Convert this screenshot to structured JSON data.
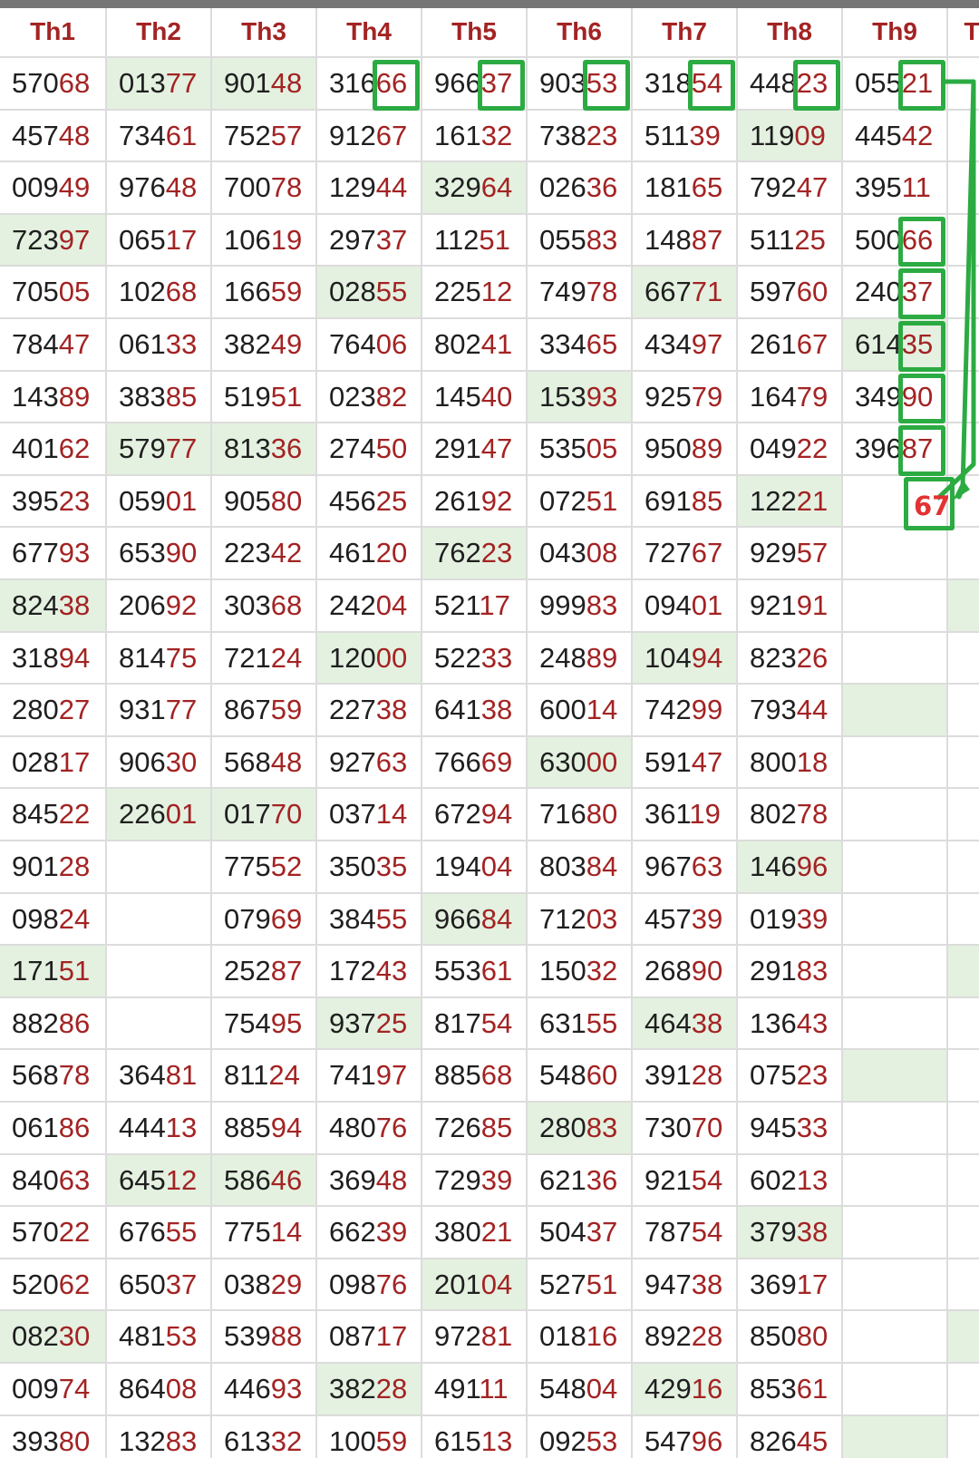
{
  "headers": [
    "Th1",
    "Th2",
    "Th3",
    "Th4",
    "Th5",
    "Th6",
    "Th7",
    "Th8",
    "Th9",
    "T"
  ],
  "rows": [
    [
      "57068",
      "01377",
      "90148",
      "31666",
      "96637",
      "90353",
      "31854",
      "44823",
      "05521",
      ""
    ],
    [
      "45748",
      "73461",
      "75257",
      "91267",
      "16132",
      "73823",
      "51139",
      "11909",
      "44542",
      ""
    ],
    [
      "00949",
      "97648",
      "70078",
      "12944",
      "32964",
      "02636",
      "18165",
      "79247",
      "39511",
      ""
    ],
    [
      "72397",
      "06517",
      "10619",
      "29737",
      "11251",
      "05583",
      "14887",
      "51125",
      "50066",
      ""
    ],
    [
      "70505",
      "10268",
      "16659",
      "02855",
      "22512",
      "74978",
      "66771",
      "59760",
      "24037",
      ""
    ],
    [
      "78447",
      "06133",
      "38249",
      "76406",
      "80241",
      "33465",
      "43497",
      "26167",
      "61435",
      ""
    ],
    [
      "14389",
      "38385",
      "51951",
      "02382",
      "14540",
      "15393",
      "92579",
      "16479",
      "34990",
      ""
    ],
    [
      "40162",
      "57977",
      "81336",
      "27450",
      "29147",
      "53505",
      "95089",
      "04922",
      "39687",
      ""
    ],
    [
      "39523",
      "05901",
      "90580",
      "45625",
      "26192",
      "07251",
      "69185",
      "12221",
      "",
      ""
    ],
    [
      "67793",
      "65390",
      "22342",
      "46120",
      "76223",
      "04308",
      "72767",
      "92957",
      "",
      ""
    ],
    [
      "82438",
      "20692",
      "30368",
      "24204",
      "52117",
      "99983",
      "09401",
      "92191",
      "",
      ""
    ],
    [
      "31894",
      "81475",
      "72124",
      "12000",
      "52233",
      "24889",
      "10494",
      "82326",
      "",
      ""
    ],
    [
      "28027",
      "93177",
      "86759",
      "22738",
      "64138",
      "60014",
      "74299",
      "79344",
      "",
      ""
    ],
    [
      "02817",
      "90630",
      "56848",
      "92763",
      "76669",
      "63000",
      "59147",
      "80018",
      "",
      ""
    ],
    [
      "84522",
      "22601",
      "01770",
      "03714",
      "67294",
      "71680",
      "36119",
      "80278",
      "",
      ""
    ],
    [
      "90128",
      "",
      "77552",
      "35035",
      "19404",
      "80384",
      "96763",
      "14696",
      "",
      ""
    ],
    [
      "09824",
      "",
      "07969",
      "38455",
      "96684",
      "71203",
      "45739",
      "01939",
      "",
      ""
    ],
    [
      "17151",
      "",
      "25287",
      "17243",
      "55361",
      "15032",
      "26890",
      "29183",
      "",
      ""
    ],
    [
      "88286",
      "",
      "75495",
      "93725",
      "81754",
      "63155",
      "46438",
      "13643",
      "",
      ""
    ],
    [
      "56878",
      "36481",
      "81124",
      "74197",
      "88568",
      "54860",
      "39128",
      "07523",
      "",
      ""
    ],
    [
      "06186",
      "44413",
      "88594",
      "48076",
      "72685",
      "28083",
      "73070",
      "94533",
      "",
      ""
    ],
    [
      "84063",
      "64512",
      "58646",
      "36948",
      "72939",
      "62136",
      "92154",
      "60213",
      "",
      ""
    ],
    [
      "57022",
      "67655",
      "77514",
      "66239",
      "38021",
      "50437",
      "78754",
      "37938",
      "",
      ""
    ],
    [
      "52062",
      "65037",
      "03829",
      "09876",
      "20104",
      "52751",
      "94738",
      "36917",
      "",
      ""
    ],
    [
      "08230",
      "48153",
      "53988",
      "08717",
      "97281",
      "01816",
      "89228",
      "85080",
      "",
      ""
    ],
    [
      "00974",
      "86408",
      "44693",
      "38228",
      "49111",
      "54804",
      "42916",
      "85361",
      "",
      ""
    ],
    [
      "39380",
      "13283",
      "61332",
      "10059",
      "61513",
      "09253",
      "54796",
      "82645",
      "",
      ""
    ]
  ],
  "highlights": [
    [
      0,
      1
    ],
    [
      0,
      2
    ],
    [
      1,
      7
    ],
    [
      2,
      4
    ],
    [
      3,
      0
    ],
    [
      4,
      3
    ],
    [
      4,
      6
    ],
    [
      5,
      8
    ],
    [
      6,
      5
    ],
    [
      7,
      1
    ],
    [
      7,
      2
    ],
    [
      8,
      7
    ],
    [
      9,
      4
    ],
    [
      10,
      0
    ],
    [
      10,
      9
    ],
    [
      11,
      3
    ],
    [
      11,
      6
    ],
    [
      12,
      8
    ],
    [
      13,
      5
    ],
    [
      14,
      1
    ],
    [
      14,
      2
    ],
    [
      15,
      7
    ],
    [
      16,
      4
    ],
    [
      17,
      0
    ],
    [
      17,
      9
    ],
    [
      18,
      3
    ],
    [
      18,
      6
    ],
    [
      19,
      8
    ],
    [
      20,
      5
    ],
    [
      21,
      1
    ],
    [
      21,
      2
    ],
    [
      22,
      7
    ],
    [
      23,
      4
    ],
    [
      24,
      0
    ],
    [
      24,
      9
    ],
    [
      25,
      3
    ],
    [
      25,
      6
    ],
    [
      26,
      8
    ]
  ],
  "annotation": {
    "boxed_cells": [
      [
        0,
        3
      ],
      [
        0,
        4
      ],
      [
        0,
        5
      ],
      [
        0,
        6
      ],
      [
        0,
        7
      ],
      [
        0,
        8
      ],
      [
        3,
        8
      ],
      [
        4,
        8
      ],
      [
        5,
        8
      ],
      [
        6,
        8
      ],
      [
        7,
        8
      ]
    ],
    "result": "67",
    "colors": {
      "box": "#2bab42",
      "result_text": "#e23232"
    }
  },
  "colors": {
    "header_text": "#a32323",
    "number_text": "#1f1f1f",
    "tail_digits": "#a32323",
    "highlight_bg": "#e4f1e0",
    "grid_line": "#dcdcdc"
  }
}
